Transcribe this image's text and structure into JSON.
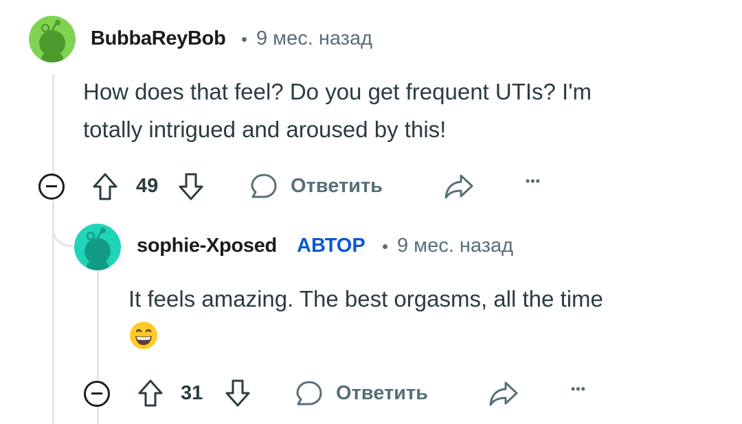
{
  "comments": [
    {
      "username": "BubbaReyBob",
      "separator": "•",
      "time": "9 мес. назад",
      "body_lines": [
        "How does that feel? Do you get frequent UTIs? I'm",
        "totally intrigued and aroused by this!"
      ],
      "votes": "49",
      "reply_label": "Ответить",
      "more": "•••",
      "avatar_color": "#7fd351"
    },
    {
      "username": "sophie-Xposed",
      "badge": "АВТОР",
      "separator": "•",
      "time": "9 мес. назад",
      "body_line": "It feels amazing. The best orgasms, all the time",
      "emoji": "😄",
      "votes": "31",
      "reply_label": "Ответить",
      "more": "•••",
      "avatar_color": "#21d4b8"
    }
  ],
  "colors": {
    "text": "#1c1c1c",
    "muted": "#576f76",
    "op_badge": "#0a57d0",
    "thread_line": "#e3e6e8"
  }
}
